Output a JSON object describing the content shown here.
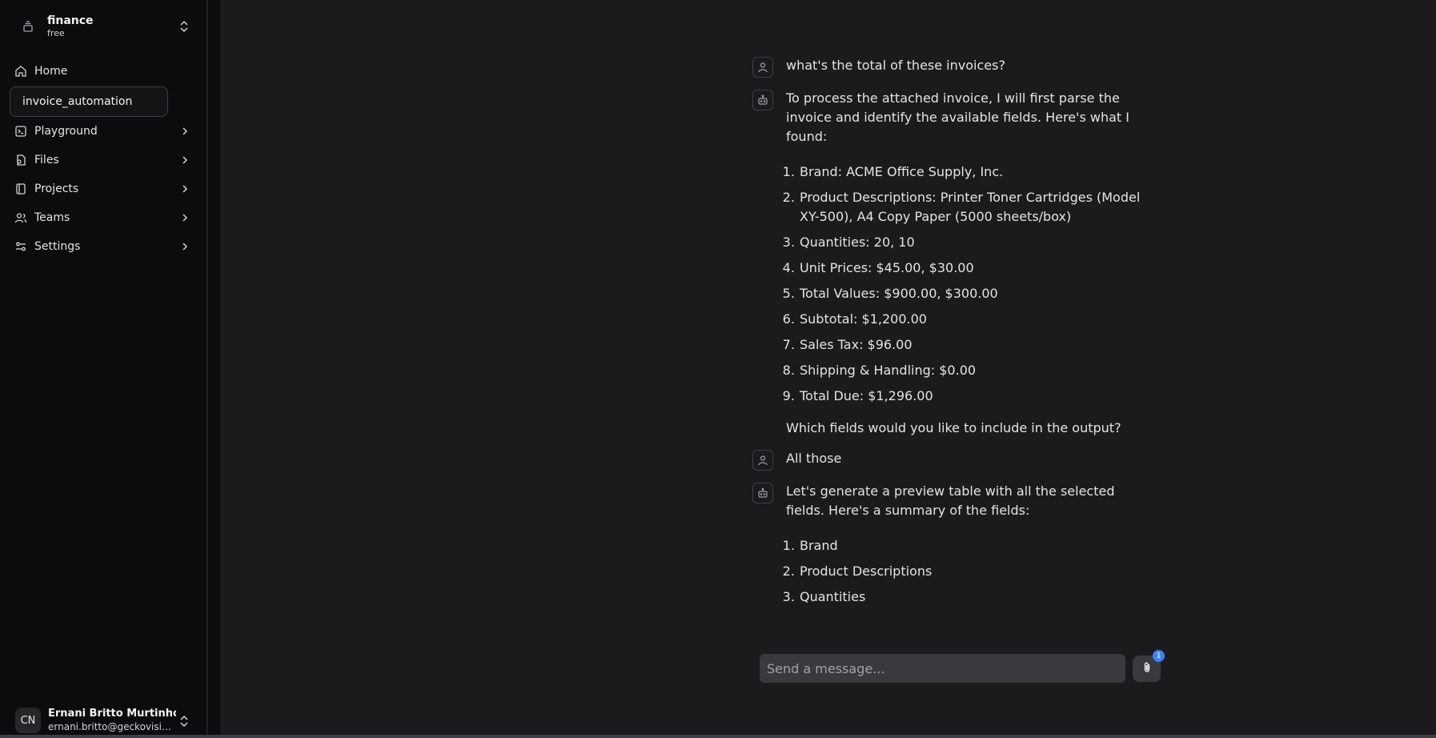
{
  "workspace": {
    "name": "finance",
    "plan": "free"
  },
  "nav": {
    "home": "Home",
    "active_project": "invoice_automation",
    "playground": "Playground",
    "files": "Files",
    "projects": "Projects",
    "teams": "Teams",
    "settings": "Settings"
  },
  "user": {
    "initials": "CN",
    "name": "Ernani Britto Murtinho",
    "email": "ernani.britto@geckovisio..."
  },
  "chat": {
    "messages": [
      {
        "role": "user",
        "text": "what's the total of these invoices?"
      },
      {
        "role": "assistant",
        "intro": "To process the attached invoice, I will first parse the invoice and identify the available fields. Here's what I found:",
        "items": [
          "Brand: ACME Office Supply, Inc.",
          "Product Descriptions: Printer Toner Cartridges (Model XY-500), A4 Copy Paper (5000 sheets/box)",
          "Quantities: 20, 10",
          "Unit Prices: $45.00, $30.00",
          "Total Values: $900.00, $300.00",
          "Subtotal: $1,200.00",
          "Sales Tax: $96.00",
          "Shipping & Handling: $0.00",
          "Total Due: $1,296.00"
        ],
        "outro": "Which fields would you like to include in the output?"
      },
      {
        "role": "user",
        "text": "All those"
      },
      {
        "role": "assistant",
        "intro": "Let's generate a preview table with all the selected fields. Here's a summary of the fields:",
        "items": [
          "Brand",
          "Product Descriptions",
          "Quantities"
        ]
      }
    ]
  },
  "composer": {
    "placeholder": "Send a message...",
    "attachment_count": "1"
  }
}
